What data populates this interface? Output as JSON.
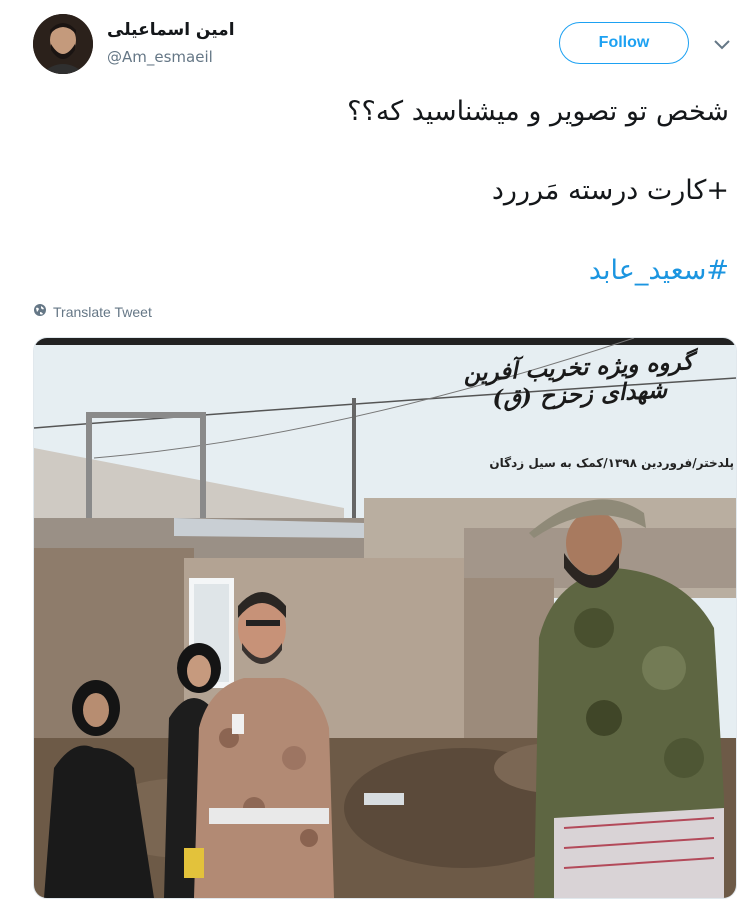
{
  "user": {
    "display_name": "امین اسماعیلی",
    "handle": "@Am_esmaeil"
  },
  "actions": {
    "follow_label": "Follow",
    "menu_icon": "chevron-down-icon"
  },
  "tweet": {
    "lines": [
      "شخص تو تصویر و میشناسید که؟؟",
      "+کارت درسته مَرررد"
    ],
    "hashtag": "#سعید_عابد"
  },
  "translate": {
    "icon": "globe-icon",
    "label": "Translate Tweet"
  },
  "photo": {
    "overlay_title": "گروه ویژه تخریب آفرین شهدای زحزح (ق)",
    "overlay_subtitle": "پلدختر/فروردین ۱۳۹۸/کمک به سیل زدگان"
  },
  "colors": {
    "accent": "#1da1f2",
    "hashtag": "#1b95e0",
    "secondary_text": "#657786",
    "primary_text": "#14171a"
  }
}
